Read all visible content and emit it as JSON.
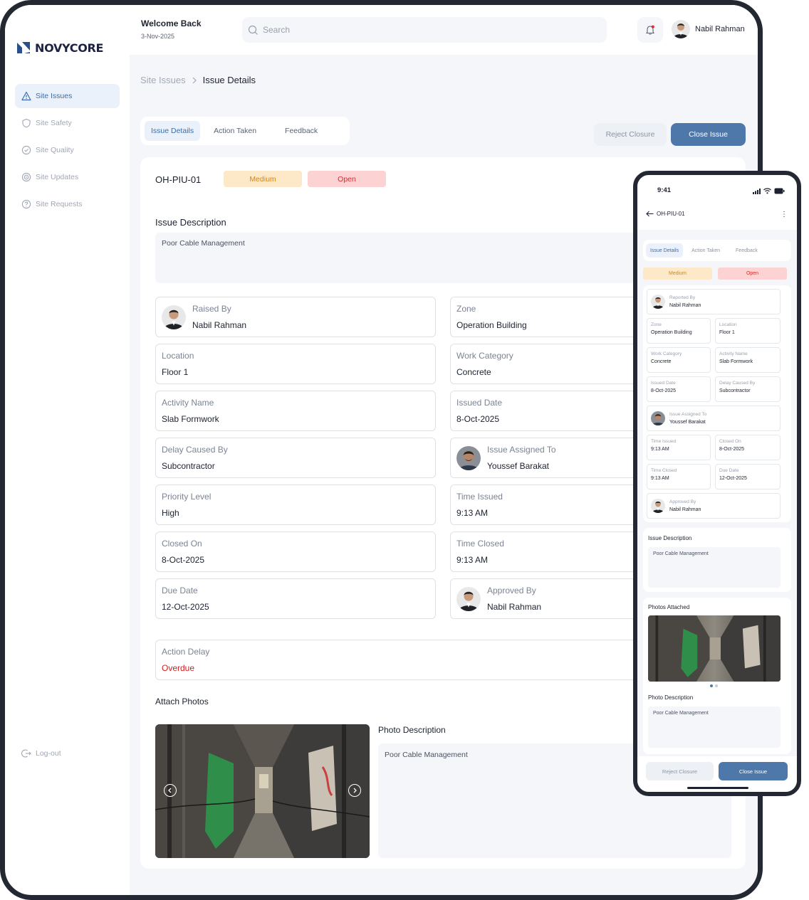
{
  "brand": {
    "name": "NOVYCORE"
  },
  "sidebar": {
    "items": [
      {
        "label": "Site Issues",
        "icon": "warning-icon",
        "active": true
      },
      {
        "label": "Site Safety",
        "icon": "shield-icon",
        "active": false
      },
      {
        "label": "Site Quality",
        "icon": "check-circle-icon",
        "active": false
      },
      {
        "label": "Site Updates",
        "icon": "target-icon",
        "active": false
      },
      {
        "label": "Site Requests",
        "icon": "question-icon",
        "active": false
      }
    ],
    "logout": "Log-out"
  },
  "header": {
    "welcome": "Welcome Back",
    "date": "3-Nov-2025",
    "search_placeholder": "Search",
    "user_name": "Nabil Rahman"
  },
  "breadcrumb": {
    "parent": "Site Issues",
    "current": "Issue Details"
  },
  "tabs": [
    "Issue Details",
    "Action Taken",
    "Feedback"
  ],
  "actions": {
    "reject": "Reject Closure",
    "close": "Close Issue"
  },
  "issue": {
    "id": "OH-PIU-01",
    "priority_badge": "Medium",
    "status_badge": "Open",
    "description_title": "Issue Description",
    "description": "Poor Cable Management",
    "fields": {
      "raised_by": {
        "label": "Raised By",
        "value": "Nabil Rahman"
      },
      "zone": {
        "label": "Zone",
        "value": "Operation Building"
      },
      "location": {
        "label": "Location",
        "value": "Floor 1"
      },
      "work_category": {
        "label": "Work Category",
        "value": "Concrete"
      },
      "activity_name": {
        "label": "Activity Name",
        "value": "Slab Formwork"
      },
      "issued_date": {
        "label": "Issued Date",
        "value": "8-Oct-2025"
      },
      "delay_caused_by": {
        "label": "Delay Caused By",
        "value": "Subcontractor"
      },
      "issue_assigned_to": {
        "label": "Issue Assigned To",
        "value": "Youssef Barakat"
      },
      "priority_level": {
        "label": "Priority Level",
        "value": "High"
      },
      "time_issued": {
        "label": "Time Issued",
        "value": "9:13 AM"
      },
      "closed_on": {
        "label": "Closed On",
        "value": "8-Oct-2025"
      },
      "time_closed": {
        "label": "Time Closed",
        "value": "9:13 AM"
      },
      "due_date": {
        "label": "Due Date",
        "value": "12-Oct-2025"
      },
      "approved_by": {
        "label": "Approved By",
        "value": "Nabil Rahman"
      },
      "action_delay": {
        "label": "Action Delay",
        "value": "Overdue"
      }
    },
    "attach_photos_title": "Attach Photos",
    "photo_description_title": "Photo Description",
    "photo_description": "Poor Cable Management"
  },
  "phone": {
    "time": "9:41",
    "title": "OH-PIU-01",
    "reported_by_label": "Reported By",
    "photos_attached_title": "Photos Attached",
    "photo_description_title": "Photo Description"
  },
  "colors": {
    "accent": "#4f78aa",
    "medium_bg": "#fde8c8",
    "medium_text": "#d8850e",
    "open_bg": "#fdd2d2",
    "open_text": "#e0282c",
    "overdue": "#d02020"
  }
}
